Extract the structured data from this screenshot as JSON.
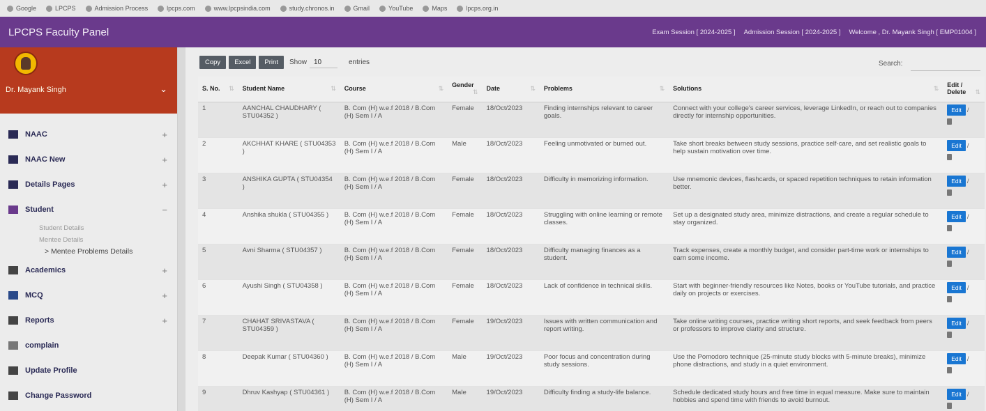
{
  "header": {
    "app_title": "LPCPS Faculty Panel",
    "exam_session": "Exam Session [ 2024-2025 ]",
    "admission_session": "Admission Session [ 2024-2025 ]",
    "welcome": "Welcome , Dr. Mayank Singh [ EMP01004 ]"
  },
  "bookmarks": [
    "Google",
    "LPCPS",
    "Admission Process",
    "lpcps.com",
    "www.lpcpsindia.com",
    "study.chronos.in",
    "Gmail",
    "YouTube",
    "Maps",
    "lpcps.org.in"
  ],
  "sidebar": {
    "profile_name": "Dr. Mayank Singh",
    "items": [
      {
        "label": "NAAC",
        "icon": "book-icon",
        "expand": "+"
      },
      {
        "label": "NAAC New",
        "icon": "book-icon",
        "expand": "+"
      },
      {
        "label": "Details Pages",
        "icon": "list-icon",
        "expand": "+"
      },
      {
        "label": "Student",
        "icon": "student-icon",
        "expand": "−"
      }
    ],
    "student_sub": [
      "Student Details",
      "Mentee Details",
      "> Mentee Problems Details"
    ],
    "items_after": [
      {
        "label": "Academics",
        "icon": "graduation-icon",
        "expand": "+"
      },
      {
        "label": "MCQ",
        "icon": "quiz-icon",
        "expand": "+"
      },
      {
        "label": "Reports",
        "icon": "chart-icon",
        "expand": "+"
      },
      {
        "label": "complain",
        "icon": "trend-icon",
        "expand": ""
      },
      {
        "label": "Update Profile",
        "icon": "profile-icon",
        "expand": ""
      },
      {
        "label": "Change Password",
        "icon": "grid-icon",
        "expand": ""
      }
    ]
  },
  "toolbar": {
    "copy": "Copy",
    "excel": "Excel",
    "print": "Print",
    "show": "Show",
    "entries_value": "10",
    "entries": "entries",
    "search": "Search:"
  },
  "table": {
    "headers": [
      "S. No.",
      "Student Name",
      "Course",
      "Gender",
      "Date",
      "Problems",
      "Solutions",
      "Edit / Delete"
    ],
    "edit_label": "Edit",
    "rows": [
      {
        "sno": "1",
        "name": "AANCHAL CHAUDHARY ( STU04352 )",
        "course": "B. Com (H) w.e.f 2018 / B.Com (H) Sem I / A",
        "gender": "Female",
        "date": "18/Oct/2023",
        "problem": "Finding internships relevant to career goals.",
        "solution": "Connect with your college's career services, leverage LinkedIn, or reach out to companies directly for internship opportunities."
      },
      {
        "sno": "2",
        "name": "AKCHHAT KHARE ( STU04353 )",
        "course": "B. Com (H) w.e.f 2018 / B.Com (H) Sem I / A",
        "gender": "Male",
        "date": "18/Oct/2023",
        "problem": "Feeling unmotivated or burned out.",
        "solution": "Take short breaks between study sessions, practice self-care, and set realistic goals to help sustain motivation over time."
      },
      {
        "sno": "3",
        "name": "ANSHIKA GUPTA ( STU04354 )",
        "course": "B. Com (H) w.e.f 2018 / B.Com (H) Sem I / A",
        "gender": "Female",
        "date": "18/Oct/2023",
        "problem": "Difficulty in memorizing information.",
        "solution": "Use mnemonic devices, flashcards, or spaced repetition techniques to retain information better."
      },
      {
        "sno": "4",
        "name": "Anshika shukla ( STU04355 )",
        "course": "B. Com (H) w.e.f 2018 / B.Com (H) Sem I / A",
        "gender": "Female",
        "date": "18/Oct/2023",
        "problem": "Struggling with online learning or remote classes.",
        "solution": "Set up a designated study area, minimize distractions, and create a regular schedule to stay organized."
      },
      {
        "sno": "5",
        "name": "Avni Sharma ( STU04357 )",
        "course": "B. Com (H) w.e.f 2018 / B.Com (H) Sem I / A",
        "gender": "Female",
        "date": "18/Oct/2023",
        "problem": "Difficulty managing finances as a student.",
        "solution": "Track expenses, create a monthly budget, and consider part-time work or internships to earn some income."
      },
      {
        "sno": "6",
        "name": "Ayushi Singh ( STU04358 )",
        "course": "B. Com (H) w.e.f 2018 / B.Com (H) Sem I / A",
        "gender": "Female",
        "date": "18/Oct/2023",
        "problem": "Lack of confidence in technical skills.",
        "solution": "Start with beginner-friendly resources like Notes, books or YouTube tutorials, and practice daily on projects or exercises."
      },
      {
        "sno": "7",
        "name": "CHAHAT SRIVASTAVA ( STU04359 )",
        "course": "B. Com (H) w.e.f 2018 / B.Com (H) Sem I / A",
        "gender": "Female",
        "date": "19/Oct/2023",
        "problem": "Issues with written communication and report writing.",
        "solution": "Take online writing courses, practice writing short reports, and seek feedback from peers or professors to improve clarity and structure."
      },
      {
        "sno": "8",
        "name": "Deepak Kumar ( STU04360 )",
        "course": "B. Com (H) w.e.f 2018 / B.Com (H) Sem I / A",
        "gender": "Male",
        "date": "19/Oct/2023",
        "problem": "Poor focus and concentration during study sessions.",
        "solution": "Use the Pomodoro technique (25-minute study blocks with 5-minute breaks), minimize phone distractions, and study in a quiet environment."
      },
      {
        "sno": "9",
        "name": "Dhruv Kashyap ( STU04361 )",
        "course": "B. Com (H) w.e.f 2018 / B.Com (H) Sem I / A",
        "gender": "Male",
        "date": "19/Oct/2023",
        "problem": "Difficulty finding a study-life balance.",
        "solution": "Schedule dedicated study hours and free time in equal measure. Make sure to maintain hobbies and spend time with friends to avoid burnout."
      }
    ]
  }
}
